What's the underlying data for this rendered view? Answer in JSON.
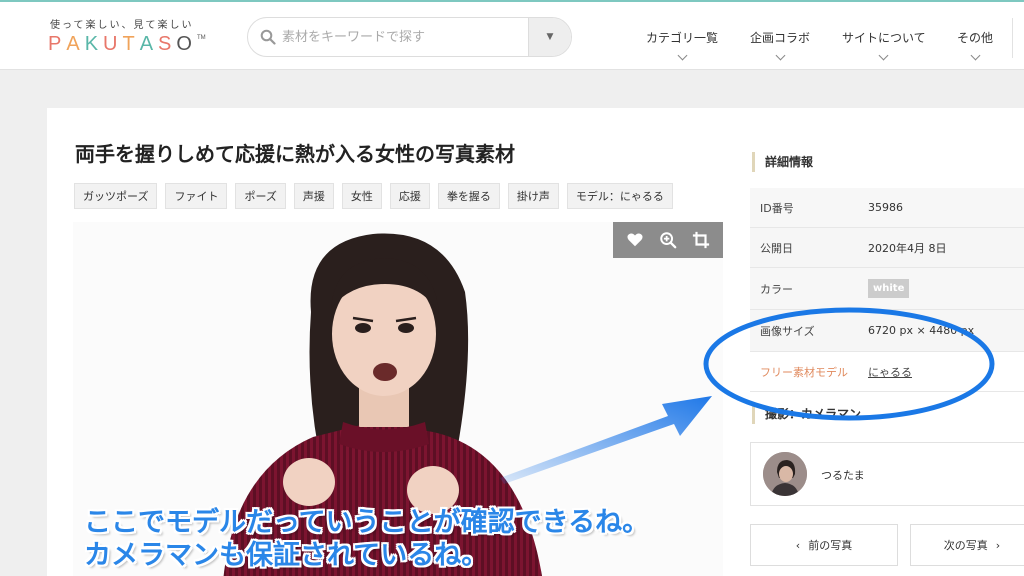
{
  "header": {
    "tagline": "使って楽しい、見て楽しい",
    "logo_letters": [
      {
        "ch": "P",
        "color": "#e8776a"
      },
      {
        "ch": "A",
        "color": "#f0a35a"
      },
      {
        "ch": "K",
        "color": "#59b7a8"
      },
      {
        "ch": "U",
        "color": "#e8776a"
      },
      {
        "ch": "T",
        "color": "#f0a35a"
      },
      {
        "ch": "A",
        "color": "#59b7a8"
      },
      {
        "ch": "S",
        "color": "#e8776a"
      },
      {
        "ch": "O",
        "color": "#555555"
      }
    ],
    "logo_tm": "TM",
    "search_placeholder": "素材をキーワードで探す",
    "nav": [
      "カテゴリ一覧",
      "企画コラボ",
      "サイトについて",
      "その他"
    ]
  },
  "main": {
    "title": "両手を握りしめて応援に熱が入る女性の写真素材",
    "tags": [
      "ガッツポーズ",
      "ファイト",
      "ポーズ",
      "声援",
      "女性",
      "応援",
      "拳を握る",
      "掛け声",
      "モデル：にゃるる"
    ]
  },
  "sidebar": {
    "details_heading": "詳細情報",
    "rows": [
      {
        "label": "ID番号",
        "value": "35986"
      },
      {
        "label": "公開日",
        "value": "2020年4月 8日"
      },
      {
        "label": "カラー",
        "value": "white"
      },
      {
        "label": "画像サイズ",
        "value": "6720 px × 4480 px"
      },
      {
        "label": "フリー素材モデル",
        "value": "にゃるる"
      }
    ],
    "photographer_heading": "撮影：カメラマン",
    "photographer_name": "つるたま",
    "prev_label": "前の写真",
    "next_label": "次の写真"
  },
  "annotation": {
    "line1": "ここでモデルだっていうことが確認できるね。",
    "line2": "カメラマンも保証されているね。",
    "color": "#2a86e8"
  }
}
